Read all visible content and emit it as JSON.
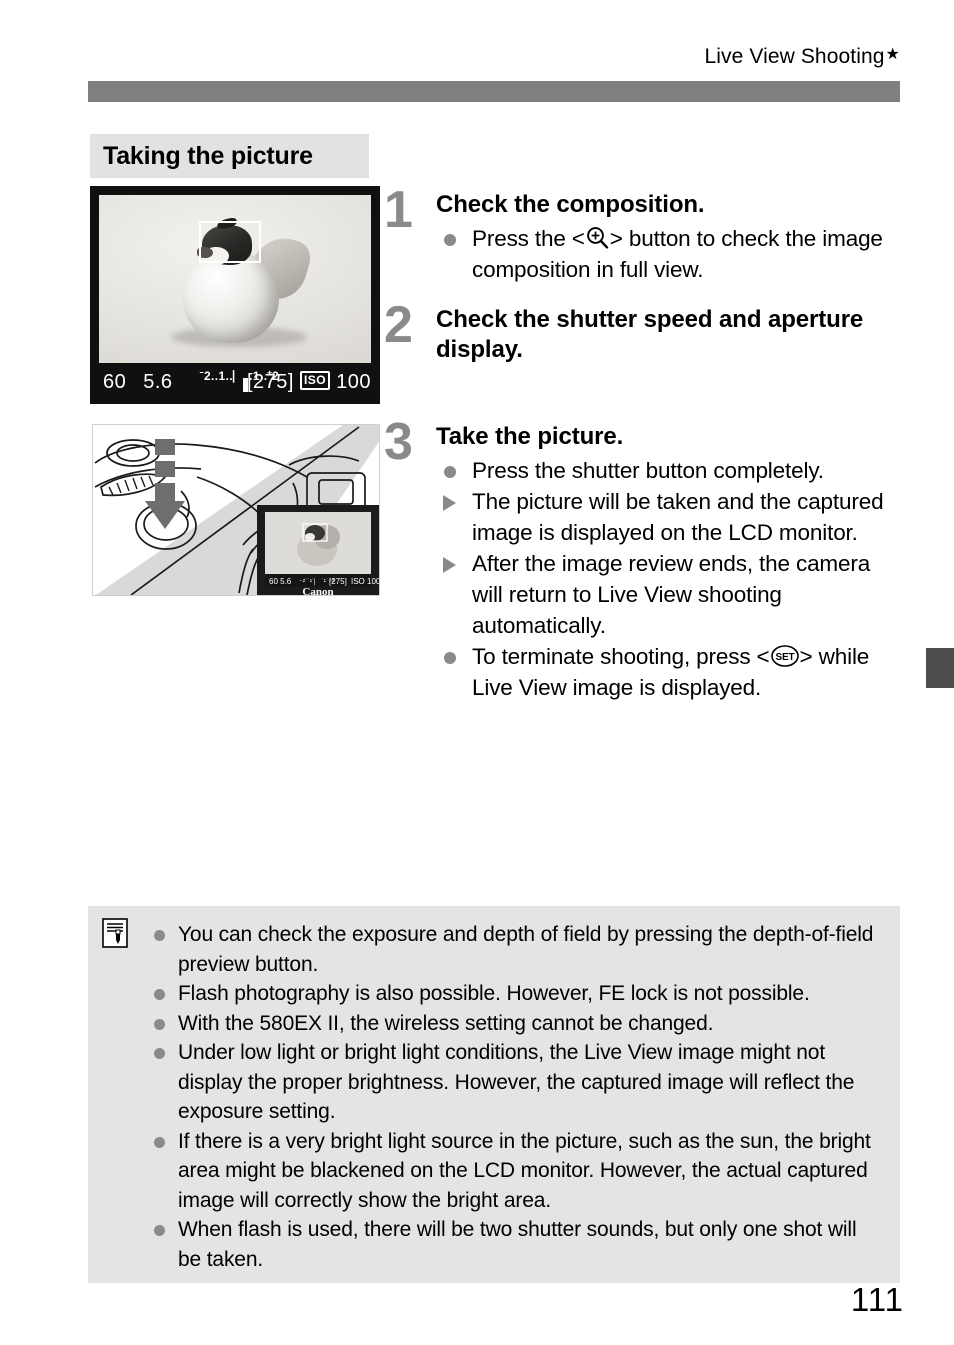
{
  "header": {
    "running_head": "Live View Shooting",
    "star_glyph": "★"
  },
  "section": {
    "title": "Taking the picture"
  },
  "figures": {
    "lcd_display": {
      "name": "live-view-screen",
      "shutter_speed": "60",
      "aperture": "5.6",
      "exposure_scale": "ˉ2..1..⎸..1..⁺2",
      "shots_remaining": "[275]",
      "iso_label": "ISO",
      "iso_value": "100",
      "af_frame": "AF point frame",
      "subject": "rubber duck ornament"
    },
    "camera_drawing": {
      "name": "camera-top-shutter-button",
      "caption_brand": "Canon",
      "inset_display": {
        "shutter_speed": "60",
        "aperture": "5.6",
        "shots_remaining": "[275]",
        "iso_label": "ISO",
        "iso_value": "100"
      }
    }
  },
  "steps": [
    {
      "number": "1",
      "heading": "Check the composition.",
      "items": [
        {
          "marker": "dot",
          "parts": [
            {
              "type": "text",
              "value": "Press the <"
            },
            {
              "type": "icon",
              "value": "magnify-plus-icon"
            },
            {
              "type": "text",
              "value": "> button to check the image composition in full view."
            }
          ],
          "text": "Press the < > button to check the image composition in full view."
        }
      ]
    },
    {
      "number": "2",
      "heading": "Check the shutter speed and aperture display.",
      "items": []
    },
    {
      "number": "3",
      "heading": "Take the picture.",
      "items": [
        {
          "marker": "dot",
          "text": "Press the shutter button completely."
        },
        {
          "marker": "triangle",
          "text": "The picture will be taken and the captured image is displayed on the LCD monitor."
        },
        {
          "marker": "triangle",
          "text": "After the image review ends, the camera will return to Live View shooting automatically."
        },
        {
          "marker": "dot",
          "parts": [
            {
              "type": "text",
              "value": "To terminate shooting, press <"
            },
            {
              "type": "icon",
              "value": "set-button-icon"
            },
            {
              "type": "text",
              "value": "> while Live View image is displayed."
            }
          ],
          "text": "To terminate shooting, press < > while Live View image is displayed."
        }
      ]
    }
  ],
  "note_box": {
    "icon": "note-pencil-icon",
    "items": [
      "You can check the exposure and depth of field by pressing the depth-of-field preview button.",
      "Flash photography is also possible. However, FE lock is not possible.",
      "With the 580EX II, the wireless setting cannot be changed.",
      "Under low light or bright light conditions, the Live View image might not display the proper brightness. However, the captured image will reflect the exposure setting.",
      "If there is a very bright light source in the picture, such as the sun, the bright area might be blackened on the LCD monitor. However, the actual captured image will correctly show the bright area.",
      "When flash is used, there will be two shutter sounds, but only one shot will be taken."
    ]
  },
  "footer": {
    "page_number": "111"
  },
  "colors": {
    "rule_gray": "#808080",
    "section_bg": "#e2e2e2",
    "note_bg": "#e4e4e4",
    "marker_gray": "#8a8a8a",
    "edge_tab": "#4d4d4d"
  }
}
